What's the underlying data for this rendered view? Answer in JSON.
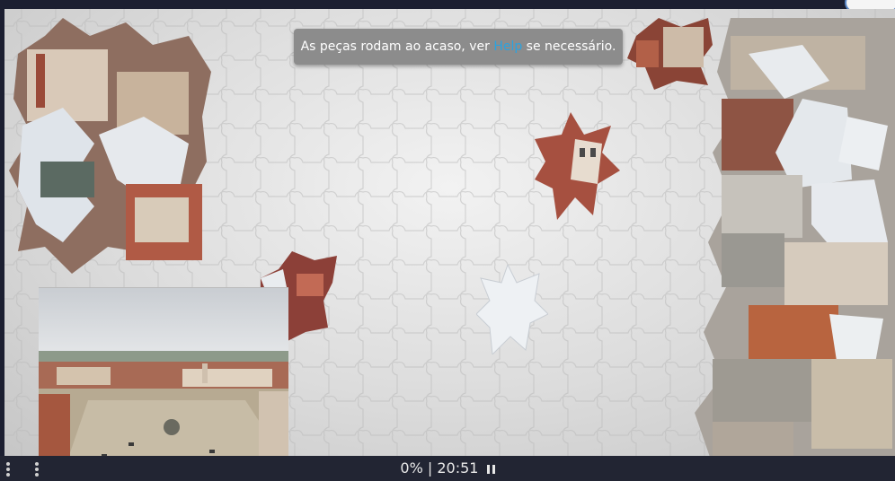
{
  "banner": {
    "text_before": "As peças rodam ao acaso, ver ",
    "link_text": "Help",
    "text_after": " se necessário."
  },
  "status": {
    "progress": "0%",
    "separator": "|",
    "timer": "20:51"
  },
  "icons": {
    "pause": "pause-icon",
    "menu_left": "vertical-dots-icon",
    "menu_left_2": "vertical-dots-icon"
  },
  "colors": {
    "banner_bg": "#8c8c8c",
    "link": "#2aa3e0",
    "bar_bg": "#222533",
    "board_bg": "#dcdcdc"
  }
}
